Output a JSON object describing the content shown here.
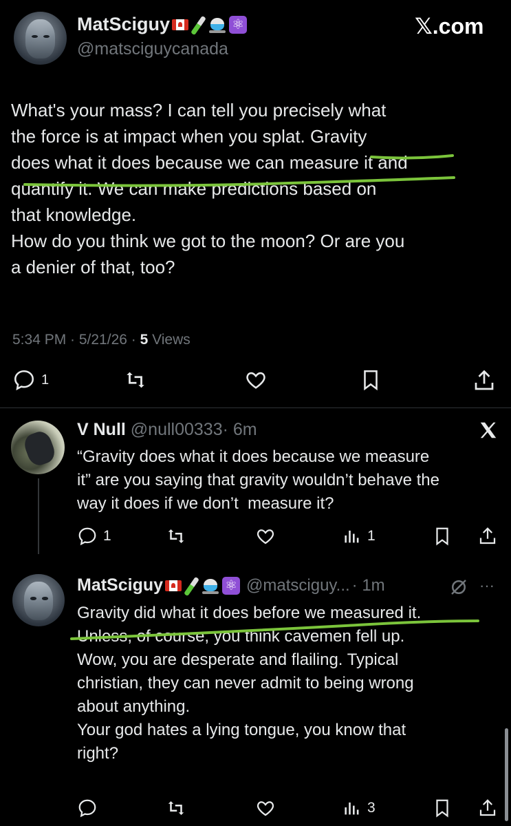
{
  "main_tweet": {
    "display_name": "MatSciguy",
    "handle": "@matsciguycanada",
    "brand": "𝕏.com",
    "text": "What's your mass? I can tell you precisely what\nthe force is at impact when you splat. Gravity\ndoes what it does because we can measure it and\nquantify it. We can make predictions based on\nthat knowledge.\nHow do you think we got to the moon? Or are you\na denier of that, too?",
    "time": "5:34 PM · 5/21/26 ·",
    "views_count": "5",
    "views_label": "Views",
    "reply_count": "1"
  },
  "reply1": {
    "display_name": "V Null",
    "handle": "@null00333",
    "age": "· 6m",
    "text": "“Gravity does what it does because we measure\nit” are you saying that gravity wouldn’t behave the\nway it does if we don’t  measure it?",
    "reply_count": "1",
    "views_count": "1"
  },
  "reply2": {
    "display_name": "MatSciguy",
    "handle": "@matsciguy...",
    "age": "· 1m",
    "more": "···",
    "text": "Gravity did what it does before we measured it.\nUnless, of course, you think cavemen fell up.\nWow, you are desperate and flailing. Typical\nchristian, they can never admit to being wrong\nabout anything.\nYour god hates a lying tongue, you know that\nright?",
    "views_count": "3"
  },
  "icons": [
    "flag-canada-icon",
    "test-tube-icon",
    "flask-icon",
    "atom-icon",
    "reply-icon",
    "retweet-icon",
    "like-icon",
    "bookmark-icon",
    "share-icon",
    "views-icon",
    "x-logo-icon",
    "grok-icon"
  ],
  "colors": {
    "background": "#000000",
    "text": "#e7e9ea",
    "muted": "#71767b",
    "highlight": "#7bc43b"
  }
}
